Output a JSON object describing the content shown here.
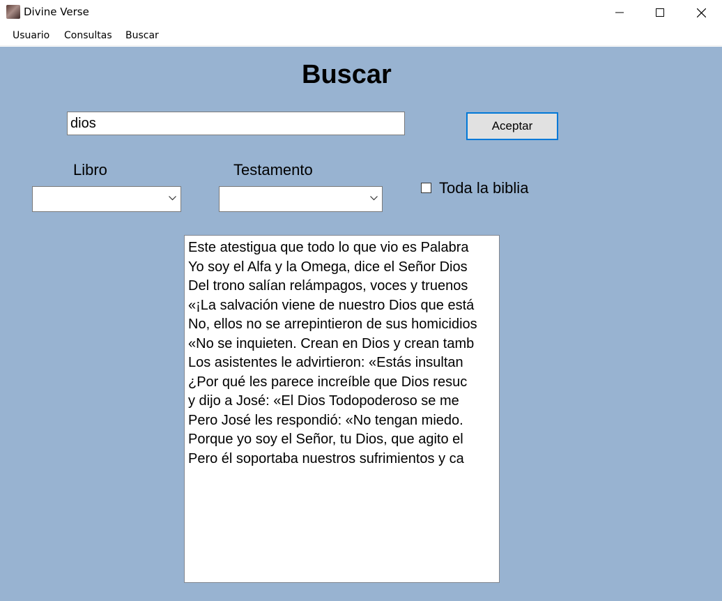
{
  "window": {
    "title": "Divine Verse",
    "icon": "app-icon",
    "controls": [
      "minimize-icon",
      "maximize-icon",
      "close-icon"
    ]
  },
  "menu": {
    "items": [
      {
        "label": "Usuario"
      },
      {
        "label": "Consultas"
      },
      {
        "label": "Buscar"
      }
    ]
  },
  "form": {
    "heading": "Buscar",
    "search_value": "dios",
    "accept_label": "Aceptar",
    "libro_label": "Libro",
    "libro_value": "",
    "testamento_label": "Testamento",
    "testamento_value": "",
    "all_bible_label": "Toda la biblia",
    "all_bible_checked": false
  },
  "results": [
    "Este atestigua que todo lo que vio es Palabra",
    "Yo soy el Alfa y la Omega, dice el Señor Dios",
    "Del trono salían relámpagos, voces y truenos",
    "«¡La salvación viene de nuestro Dios que está",
    "No, ellos no se arrepintieron de sus homicidios",
    "«No se inquieten. Crean en Dios y crean tamb",
    "Los asistentes le advirtieron: «Estás insultan",
    "¿Por qué les parece increíble que Dios resuc",
    " y dijo a José: «El Dios Todopoderoso se me",
    "Pero José les respondió: «No tengan miedo.",
    "Porque yo soy el Señor, tu Dios, que agito el",
    "Pero él soportaba nuestros sufrimientos y ca"
  ],
  "colors": {
    "client_background": "#98b3d1",
    "button_focus_border": "#0078d7"
  }
}
